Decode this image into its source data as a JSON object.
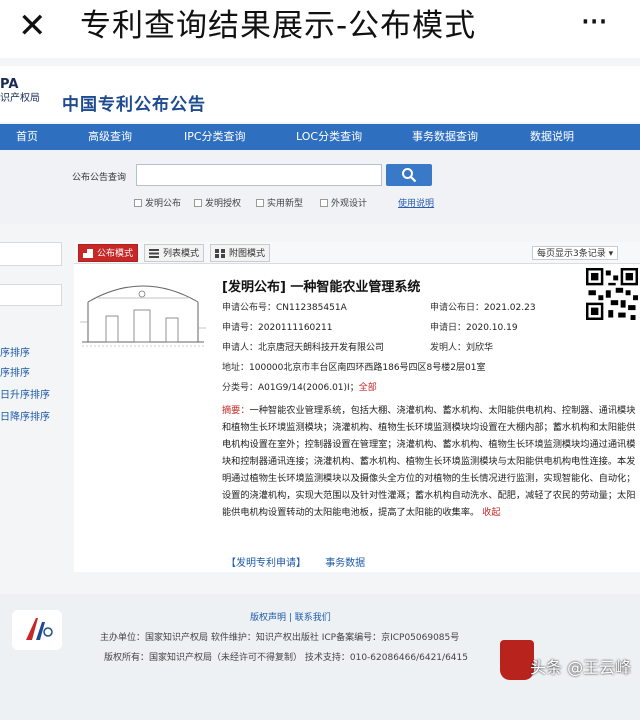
{
  "phone": {
    "close_glyph": "✕",
    "title": "专利查询结果展示-公布模式",
    "more_glyph": "···"
  },
  "site": {
    "logo_line1": "PA",
    "logo_line2": "识产权局",
    "title": "中国专利公布公告"
  },
  "nav": {
    "items": [
      "首页",
      "高级查询",
      "IPC分类查询",
      "LOC分类查询",
      "事务数据查询",
      "数据说明"
    ]
  },
  "search": {
    "label": "公布公告查询",
    "value": "",
    "button_icon": "search-icon",
    "options": [
      "发明公布",
      "发明授权",
      "实用新型",
      "外观设计"
    ],
    "help": "使用说明"
  },
  "sidebar": {
    "sort_links": [
      "序排序",
      "序排序",
      "日升序排序",
      "日降序排序"
    ]
  },
  "results": {
    "modes": [
      "公布模式",
      "列表模式",
      "附图模式"
    ],
    "per_page": "每页显示3条记录 ▾",
    "record": {
      "title": "[发明公布] 一种智能农业管理系统",
      "pub_no_label": "申请公布号：",
      "pub_no": "CN112385451A",
      "pub_date_label": "申请公布日：",
      "pub_date": "2021.02.23",
      "app_no_label": "申请号：",
      "app_no": "2020111160211",
      "app_date_label": "申请日：",
      "app_date": "2020.10.19",
      "applicant_label": "申请人：",
      "applicant": "北京唐冠天朗科技开发有限公司",
      "inventor_label": "发明人：",
      "inventor": "刘欣华",
      "address_label": "地址：",
      "address": "100000北京市丰台区南四环西路186号四区8号楼2层01室",
      "class_label": "分类号：",
      "class_no": "A01G9/14(2006.01)I；",
      "class_all": "全部",
      "abstract_label": "摘要：",
      "abstract": "一种智能农业管理系统，包括大棚、浇灌机构、蓄水机构、太阳能供电机构、控制器、通讯模块和植物生长环境监测模块；浇灌机构、植物生长环境监测模块均设置在大棚内部；蓄水机构和太阳能供电机构设置在室外；控制器设置在管理室；浇灌机构、蓄水机构、植物生长环境监测模块均通过通讯模块和控制器通讯连接；浇灌机构、蓄水机构、植物生长环境监测模块与太阳能供电机构电性连接。本发明通过植物生长环境监测模块以及摄像头全方位的对植物的生长情况进行监测，实现智能化、自动化；设置的浇灌机构，实现大范围以及针对性灌溉；蓄水机构自动洗水、配肥，减轻了农民的劳动量；太阳能供电机构设置转动的太阳能电池板，提高了太阳能的收集率。",
      "collapse": "收起",
      "links": [
        "【发明专利申请】",
        "事务数据"
      ]
    }
  },
  "footer": {
    "links": "版权声明 | 联系我们",
    "line1": "主办单位：国家知识产权局   软件维护：知识产权出版社   ICP备案编号：京ICP05069085号",
    "line2": "版权所有：国家知识产权局（未经许可不得复制）   技术支持：010-62086466/6421/6415"
  },
  "watermark": {
    "text": "头条 @王云峰"
  },
  "colors": {
    "nav": "#2f6fbf",
    "accent_red": "#c62828",
    "link_blue": "#1d5aa8"
  }
}
